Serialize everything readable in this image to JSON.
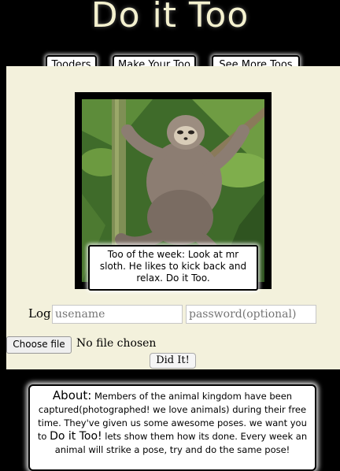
{
  "site": {
    "title": "Do it Too"
  },
  "nav": {
    "items": [
      {
        "label": "Tooders"
      },
      {
        "label": "Make Your Too"
      },
      {
        "label": "See More Toos"
      }
    ]
  },
  "featured": {
    "caption": "Too of the week: Look at mr sloth. He likes to kick back and relax.  Do it Too."
  },
  "login": {
    "label": "Log",
    "username_placeholder": "usename",
    "password_placeholder": "password(optional)"
  },
  "upload": {
    "choose_label": "Choose file",
    "status": "No file chosen",
    "submit_label": "Did It!"
  },
  "about": {
    "heading": "About:",
    "text_1": "Members of the animal kingdom have been captured(photographed! we love animals) during their free time. They've given us some awesome poses. we want you to",
    "emphasis": "Do it Too!",
    "text_2": "lets show them how its done. Every week an animal will strike a pose, try and do the same pose!"
  },
  "colors": {
    "background": "#000000",
    "panel": "#f3f1dc",
    "title": "#f4f1cf"
  }
}
